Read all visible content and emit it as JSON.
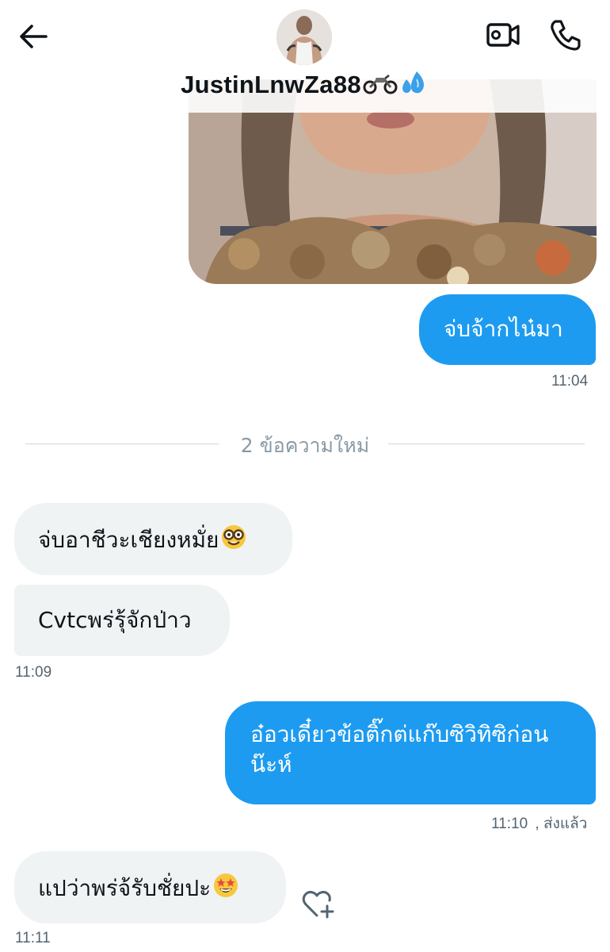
{
  "header": {
    "back_icon": "arrow-left-icon",
    "username": "JustinLnwZa88",
    "username_emojis": [
      "motorcycle",
      "sweat-droplets"
    ],
    "video_icon": "video-camera-icon",
    "phone_icon": "phone-icon"
  },
  "messages": [
    {
      "direction": "out",
      "type": "image",
      "description_icon": "photo"
    },
    {
      "direction": "out",
      "text": "จ่บจ้ากไน๋มา"
    },
    {
      "direction": "out",
      "time": "11:04"
    },
    {
      "direction": "in",
      "text": "จ่บอาชีวะเชียงหมั่ย",
      "emoji": "nerd-face"
    },
    {
      "direction": "in",
      "text": "Cvtcพร่รุ้จักป่าว"
    },
    {
      "direction": "in",
      "time": "11:09"
    },
    {
      "direction": "out",
      "text_line1": "อ๋อวเดี๋ยวข้อติ๊กต่แก๊บซิวิทิซิก่อน",
      "text_line2": "น๊ะห์"
    },
    {
      "direction": "out",
      "time": "11:10",
      "status": ", ส่งแล้ว"
    },
    {
      "direction": "in",
      "text": "แปว่าพร่จ้รับชั่ยปะ",
      "emoji": "star-struck"
    },
    {
      "direction": "in",
      "time": "11:11"
    }
  ],
  "divider": {
    "label": "2 ข้อความใหม่"
  },
  "colors": {
    "outgoing": "#1d9bf0",
    "incoming": "#eff3f4",
    "timestamp": "#536471"
  }
}
